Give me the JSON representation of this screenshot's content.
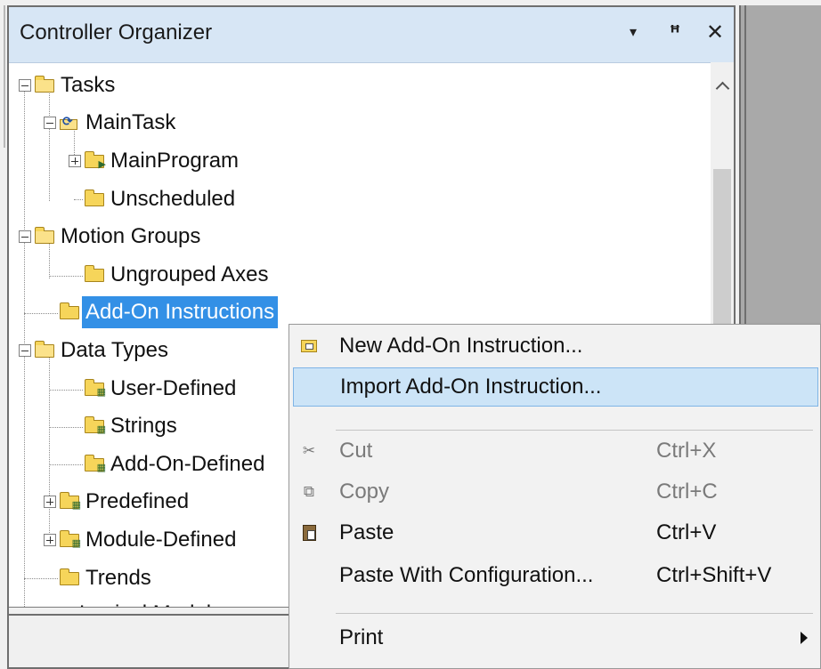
{
  "panel": {
    "title": "Controller Organizer",
    "buttons": {
      "dropdown": "▾",
      "pin": "ꟸ",
      "close": "✕"
    }
  },
  "tree": {
    "items": [
      {
        "label": "Tasks",
        "expander": "minus",
        "icon": "folder-open-icon"
      },
      {
        "label": "MainTask",
        "expander": "minus",
        "icon": "task-icon"
      },
      {
        "label": "MainProgram",
        "expander": "plus",
        "icon": "program-folder-icon"
      },
      {
        "label": "Unscheduled",
        "expander": "none",
        "icon": "folder-icon"
      },
      {
        "label": "Motion Groups",
        "expander": "minus",
        "icon": "folder-open-icon"
      },
      {
        "label": "Ungrouped Axes",
        "expander": "none",
        "icon": "folder-icon"
      },
      {
        "label": "Add-On Instructions",
        "expander": "none",
        "icon": "folder-icon",
        "selected": true
      },
      {
        "label": "Data Types",
        "expander": "minus",
        "icon": "folder-open-icon"
      },
      {
        "label": "User-Defined",
        "expander": "none",
        "icon": "datatype-folder-icon"
      },
      {
        "label": "Strings",
        "expander": "none",
        "icon": "datatype-folder-icon"
      },
      {
        "label": "Add-On-Defined",
        "expander": "none",
        "icon": "datatype-folder-icon"
      },
      {
        "label": "Predefined",
        "expander": "plus",
        "icon": "datatype-folder-icon"
      },
      {
        "label": "Module-Defined",
        "expander": "plus",
        "icon": "datatype-folder-icon"
      },
      {
        "label": "Trends",
        "expander": "none",
        "icon": "folder-icon"
      },
      {
        "label": "Logical Model",
        "expander": "none",
        "icon": "logical-model-icon"
      }
    ]
  },
  "context_menu": {
    "items": [
      {
        "label": "New Add-On Instruction...",
        "shortcut": "",
        "icon": "new-aoi-icon",
        "state": "enabled"
      },
      {
        "label": "Import Add-On Instruction...",
        "shortcut": "",
        "icon": "",
        "state": "highlighted"
      },
      {
        "label": "Cut",
        "shortcut": "Ctrl+X",
        "icon": "scissors-icon",
        "state": "disabled"
      },
      {
        "label": "Copy",
        "shortcut": "Ctrl+C",
        "icon": "copy-icon",
        "state": "disabled"
      },
      {
        "label": "Paste",
        "shortcut": "Ctrl+V",
        "icon": "paste-icon",
        "state": "enabled"
      },
      {
        "label": "Paste With Configuration...",
        "shortcut": "Ctrl+Shift+V",
        "icon": "",
        "state": "enabled"
      },
      {
        "label": "Print",
        "shortcut": "",
        "icon": "",
        "state": "enabled",
        "submenu": true
      }
    ]
  },
  "colors": {
    "title_bar": "#d7e6f5",
    "selection": "#3390e6",
    "menu_highlight": "#cce4f7",
    "menu_background": "#f2f2f2"
  }
}
